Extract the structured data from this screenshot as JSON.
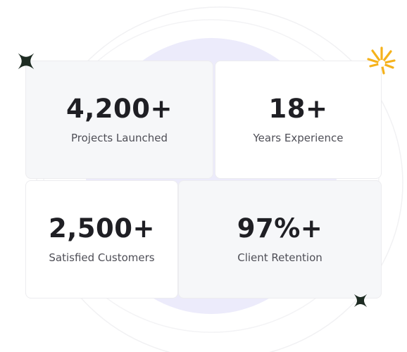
{
  "stats": [
    {
      "value": "4,200+",
      "label": "Projects Launched"
    },
    {
      "value": "18+",
      "label": "Years Experience"
    },
    {
      "value": "2,500+",
      "label": "Satisfied Customers"
    },
    {
      "value": "97%+",
      "label": "Client Retention"
    }
  ],
  "decor": {
    "star_color": "#1d2b22",
    "burst_color": "#f5b21b",
    "blob_color": "#ecebfb"
  }
}
